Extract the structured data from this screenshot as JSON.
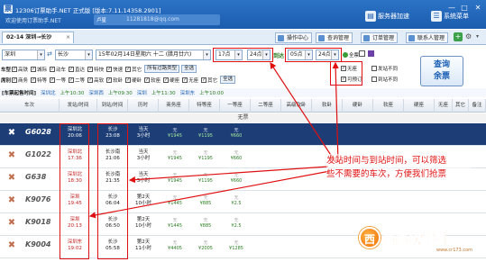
{
  "window": {
    "app_title": "12306订票助手.NET  正式版 [版本:7.11.14358.2901]",
    "welcome": "欢迎使用订票助手.NET",
    "account": "11281818@qq.com",
    "minimize": "—",
    "maximize": "□",
    "close": "✕",
    "server_speed": "服务器加速",
    "menu": "系统菜单"
  },
  "tabs": {
    "main_tab": "02-14 深圳→长沙",
    "right_tabs": [
      "操作中心",
      "查询管理",
      "订单管理",
      "联系人管理"
    ]
  },
  "search": {
    "from": "深圳",
    "to": "长沙",
    "date": "15年02月14日星期六 十二 (腊月廿六)",
    "time_from": "17点",
    "time_from_min": "24点",
    "time_to": "05点",
    "time_to_min": "24点",
    "arrive_label": "到达",
    "full_label": "全票",
    "query_label_1": "查询",
    "query_label_2": "余票"
  },
  "filters": {
    "row1_label": "车型",
    "row1": [
      "高铁",
      "城际",
      "动车",
      "直达",
      "特快",
      "快速",
      "其它",
      "所有过路类型"
    ],
    "row1_btn": "全选",
    "row2_label": "席别",
    "row2": [
      "商务",
      "特等",
      "一等",
      "二等",
      "高软",
      "软卧",
      "硬卧",
      "软座",
      "硬座",
      "无座",
      "其它"
    ],
    "row2_btn": "全选",
    "row3_label": "车次",
    "row3": [
      "推荐",
      "候补",
      "其它"
    ],
    "row3_btn": "全选"
  },
  "right_options": {
    "no_seat": "无座",
    "only_bookable": "可预订",
    "depart_filter": "发站不同",
    "arrive_filter": "到站不同",
    "student": "席别过滤",
    "show_all": "显示"
  },
  "station_bar": {
    "label": "[车票起售时间]",
    "items": [
      {
        "name": "深圳北",
        "time": "上午10:30"
      },
      {
        "name": "深圳西",
        "time": "上午09:30"
      },
      {
        "name": "深圳",
        "time": "上午11:30"
      },
      {
        "name": "深圳东",
        "time": "上午10:00"
      }
    ]
  },
  "table": {
    "headers": [
      "车次",
      "发站/时间",
      "到站/时间",
      "历时",
      "商务座",
      "特等座",
      "一等座",
      "二等座",
      "高级软卧",
      "软卧",
      "硬卧",
      "软座",
      "硬座",
      "无座",
      "其它",
      "备注"
    ],
    "no_ticket": "无票",
    "rows": [
      {
        "train": "G6028",
        "from": "深圳北",
        "dep": "20:06",
        "to": "长沙",
        "arr": "23:08",
        "dur1": "当天",
        "dur2": "3小时",
        "c1": "无",
        "c1p": "¥1945",
        "c2": "无",
        "c2p": "¥1195",
        "c3": "无",
        "c3p": "¥660"
      },
      {
        "train": "G1022",
        "from": "深圳北",
        "dep": "17:36",
        "to": "长沙南",
        "arr": "21:06",
        "dur1": "当天",
        "dur2": "3小时",
        "c1": "无",
        "c1p": "¥1945",
        "c2": "无",
        "c2p": "¥1195",
        "c3": "无",
        "c3p": "¥660"
      },
      {
        "train": "G638",
        "from": "深圳北",
        "dep": "18:30",
        "to": "长沙南",
        "arr": "21:35",
        "dur1": "当天",
        "dur2": "3小时",
        "c1": "无",
        "c1p": "¥1945",
        "c2": "无",
        "c2p": "¥1195",
        "c3": "无",
        "c3p": "¥660"
      },
      {
        "train": "K9076",
        "from": "深圳",
        "dep": "19:45",
        "to": "长沙",
        "arr": "06:04",
        "dur1": "第2天",
        "dur2": "10小时",
        "c1": "无",
        "c1p": "¥1445",
        "c2": "无",
        "c2p": "¥885",
        "c3": "无",
        "c3p": "¥2.5"
      },
      {
        "train": "K9018",
        "from": "深圳",
        "dep": "20:13",
        "to": "长沙",
        "arr": "06:50",
        "dur1": "第2天",
        "dur2": "10小时",
        "c1": "无",
        "c1p": "¥1445",
        "c2": "无",
        "c2p": "¥885",
        "c3": "无",
        "c3p": "¥2.5"
      },
      {
        "train": "K9004",
        "from": "深圳东",
        "dep": "19:02",
        "to": "长沙",
        "arr": "05:58",
        "dur1": "第2天",
        "dur2": "11小时",
        "c1": "无",
        "c1p": "¥4405",
        "c2": "无",
        "c2p": "¥2005",
        "c3": "无",
        "c3p": "¥1285"
      }
    ]
  },
  "annotation": {
    "line1": "发站时间与到站时间，可以筛选",
    "line2": "些不需要的车次，方便我们抢票"
  },
  "watermark": {
    "text": "西西软件园",
    "url": "www.cr173.com"
  },
  "colors": {
    "titlebar": "#1b5cae",
    "highlight_row": "#1c3d75",
    "annotation": "#e01010",
    "price": "#2a7d20"
  }
}
